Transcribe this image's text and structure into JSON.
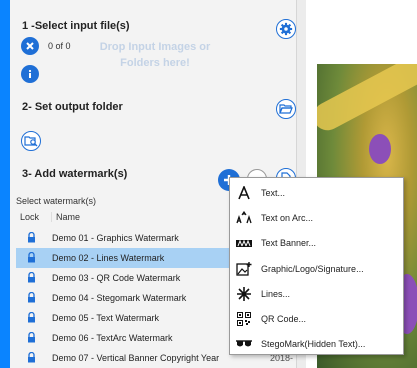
{
  "section1": {
    "title": "1 -Select input file(s)",
    "count": "0 of 0",
    "drop_hint_line1": "Drop Input Images or",
    "drop_hint_line2": "Folders here!"
  },
  "section2": {
    "title": "2- Set output folder"
  },
  "section3": {
    "title": "3- Add watermark(s)",
    "select_label": "Select watermark(s)",
    "col_lock": "Lock",
    "col_name": "Name",
    "rows": [
      {
        "name": "Demo 01 - Graphics Watermark",
        "tail": "",
        "selected": false
      },
      {
        "name": "Demo 02 - Lines Watermark",
        "tail": "",
        "selected": true
      },
      {
        "name": "Demo 03 - QR Code Watermark",
        "tail": "",
        "selected": false
      },
      {
        "name": "Demo 04 - Stegomark Watermark",
        "tail": "",
        "selected": false
      },
      {
        "name": "Demo 05 - Text Watermark",
        "tail": "",
        "selected": false
      },
      {
        "name": "Demo 06 - TextArc Watermark",
        "tail": "",
        "selected": false
      },
      {
        "name": "Demo 07 - Vertical Banner Copyright Year",
        "tail": "2018-",
        "selected": false
      }
    ]
  },
  "menu": {
    "items": [
      {
        "label": "Text...",
        "icon": "text-icon"
      },
      {
        "label": "Text on Arc...",
        "icon": "text-arc-icon"
      },
      {
        "label": "Text Banner...",
        "icon": "text-banner-icon"
      },
      {
        "label": "Graphic/Logo/Signature...",
        "icon": "image-add-icon"
      },
      {
        "label": "Lines...",
        "icon": "lines-icon"
      },
      {
        "label": "QR Code...",
        "icon": "qr-code-icon"
      },
      {
        "label": "StegoMark(Hidden Text)...",
        "icon": "sunglasses-icon"
      }
    ]
  },
  "colors": {
    "accent": "#1f6fd6",
    "selected_row": "#a8d1f4",
    "edge": "#0a84ff"
  }
}
